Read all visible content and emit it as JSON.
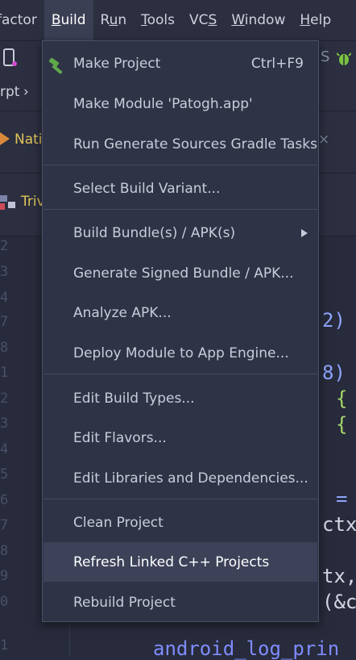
{
  "menubar": {
    "items": [
      {
        "label": "factor",
        "underline": ""
      },
      {
        "label": "uild",
        "underline": "B"
      },
      {
        "label": "un",
        "underline": "R",
        "prefix": ""
      },
      {
        "label": "ools",
        "underline": "T"
      },
      {
        "label": "VCS",
        "underline": ""
      },
      {
        "label": "indow",
        "underline": "W"
      },
      {
        "label": "elp",
        "underline": "H"
      }
    ],
    "run_prefix": "R",
    "run_underline": "u",
    "run_rest": "n",
    "vcs_prefix": "VC",
    "vcs_underline": "S"
  },
  "background": {
    "breadcrumb": "rpt",
    "breadcrumb_chevron": "›",
    "tab1_label": "Nati",
    "tab1_close": "×",
    "tab2_label": "Triv",
    "line_numbers": [
      "2",
      "3",
      "4",
      "7",
      "8",
      "1",
      "2",
      "3",
      "4",
      "5",
      "6",
      "7",
      "8",
      "9",
      "0",
      "1"
    ],
    "code_fragments": [
      {
        "text": "2)",
        "color": "#8fa6ff"
      },
      {
        "text": "8)",
        "color": "#8fa6ff"
      },
      {
        "text": "{",
        "color": "#a6d86b"
      },
      {
        "text": "{",
        "color": "#a6d86b"
      },
      {
        "text": "=",
        "color": "#8fa6ff"
      },
      {
        "text": "ctx",
        "color": "#d6d8e4"
      },
      {
        "text": "tx,",
        "color": "#d6d8e4"
      },
      {
        "text": "(&c",
        "color": "#d6d8e4"
      },
      {
        "text": "android_log_prin",
        "color": "#7f8cff"
      }
    ]
  },
  "build_menu": {
    "items": [
      {
        "label": "Make Project",
        "shortcut": "Ctrl+F9"
      },
      {
        "label": "Make Module 'Patogh.app'"
      },
      {
        "label": "Run Generate Sources Gradle Tasks"
      },
      {
        "label": "Select Build Variant..."
      },
      {
        "label": "Build Bundle(s) / APK(s)"
      },
      {
        "label": "Generate Signed Bundle / APK..."
      },
      {
        "label": "Analyze APK..."
      },
      {
        "label": "Deploy Module to App Engine..."
      },
      {
        "label": "Edit Build Types..."
      },
      {
        "label": "Edit Flavors..."
      },
      {
        "label": "Edit Libraries and Dependencies..."
      },
      {
        "label": "Clean Project"
      },
      {
        "label": "Refresh Linked C++ Projects"
      },
      {
        "label": "Rebuild Project"
      }
    ]
  },
  "colors": {
    "menu_bg": "#2f3346",
    "highlight": "#3d4259",
    "hammer": "#5fa84a",
    "bug": "#7cc241"
  }
}
